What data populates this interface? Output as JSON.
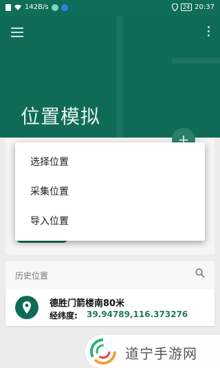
{
  "status_bar": {
    "network_speed": "142B/s",
    "battery": "24",
    "time": "20:37"
  },
  "header": {
    "title": "位置模拟"
  },
  "popup_menu": {
    "items": [
      "选择位置",
      "采集位置",
      "导入位置"
    ]
  },
  "history": {
    "label": "历史位置",
    "record": {
      "name": "德胜门箭楼南80米",
      "coord_label": "经纬度:",
      "coord_value": "39.94789,116.373276"
    }
  },
  "watermark": {
    "brand": "道宁手游网"
  },
  "colors": {
    "primary": "#0f6b58",
    "accent_text": "#1f7a5e",
    "background": "#ececec"
  }
}
